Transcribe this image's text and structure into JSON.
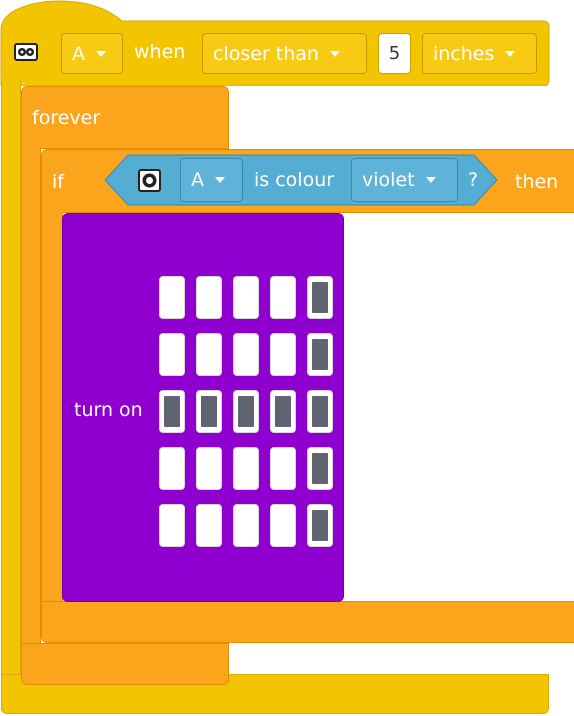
{
  "colors": {
    "event_block": "#f2c500",
    "control_block": "#fba51d",
    "sensor_block": "#56add4",
    "light_block": "#8f00d0",
    "led_on": "#5f6470",
    "led_off": "#ffffff"
  },
  "when_block": {
    "icon": "distance-sensor-icon",
    "port": "A",
    "when_label": "when",
    "comparison": "closer than",
    "distance_value": "5",
    "unit": "inches"
  },
  "forever_block": {
    "label": "forever"
  },
  "if_block": {
    "if_label": "if",
    "then_label": "then",
    "condition": {
      "icon": "color-sensor-icon",
      "port": "A",
      "is_colour_label": "is colour",
      "colour": "violet",
      "question_label": "?"
    }
  },
  "turn_on_block": {
    "label": "turn on",
    "matrix": [
      [
        0,
        0,
        0,
        0,
        1
      ],
      [
        0,
        0,
        0,
        0,
        1
      ],
      [
        1,
        1,
        1,
        1,
        1
      ],
      [
        0,
        0,
        0,
        0,
        1
      ],
      [
        0,
        0,
        0,
        0,
        1
      ]
    ]
  }
}
